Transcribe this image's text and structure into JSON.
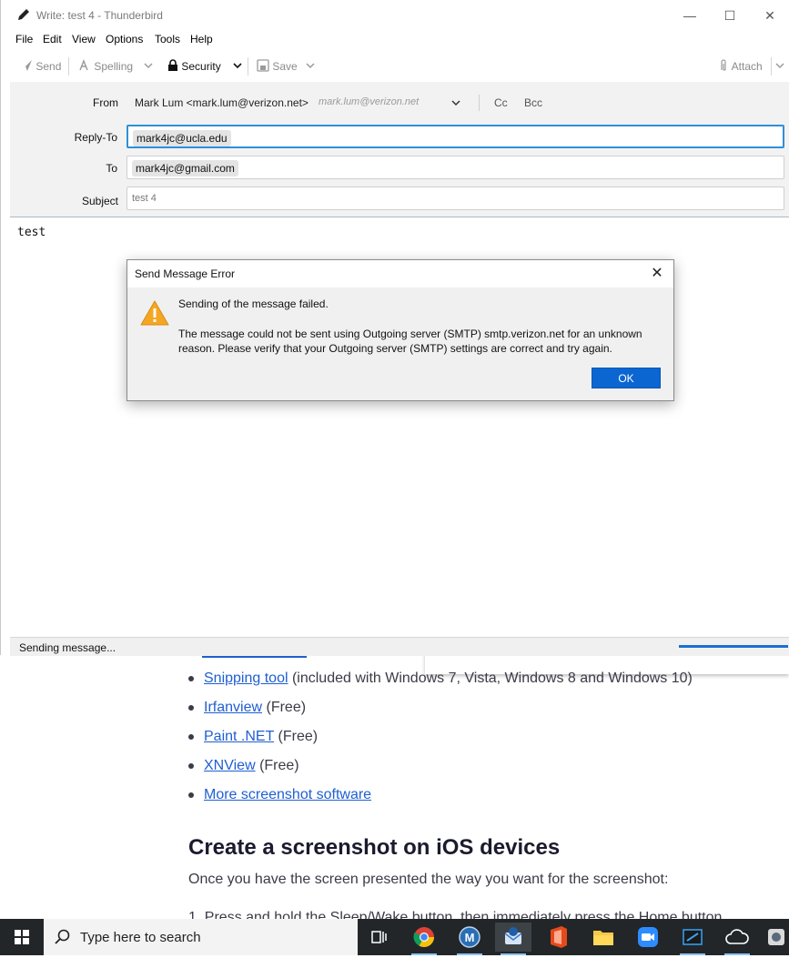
{
  "webpage": {
    "list_items": [
      {
        "link": "Snipping tool",
        "note": "(included with Windows 7, Vista, Windows 8 and Windows 10)"
      },
      {
        "link": "Irfanview",
        "note": "(Free)"
      },
      {
        "link": "Paint .NET",
        "note": "(Free)"
      },
      {
        "link": "XNView",
        "note": "(Free)"
      },
      {
        "link": "More screenshot software",
        "note": ""
      }
    ],
    "heading": "Create a screenshot on iOS devices",
    "paragraph": "Once you have the screen presented the way you want for the screenshot:",
    "cut_text": "1. Press and hold the Sleep/Wake button, then immediately press the Home button"
  },
  "window": {
    "title": "Write: test 4 - Thunderbird",
    "menu": [
      "File",
      "Edit",
      "View",
      "Options",
      "Tools",
      "Help"
    ],
    "toolbar": {
      "send": "Send",
      "spelling": "Spelling",
      "security": "Security",
      "save": "Save",
      "attach": "Attach"
    },
    "headers": {
      "from_label": "From",
      "from_value": "Mark Lum <mark.lum@verizon.net>",
      "from_ghost": "mark.lum@verizon.net",
      "cc": "Cc",
      "bcc": "Bcc",
      "reply_to_label": "Reply-To",
      "reply_to_value": "mark4jc@ucla.edu",
      "to_label": "To",
      "to_value": "mark4jc@gmail.com",
      "subject_label": "Subject",
      "subject_value": "test 4"
    },
    "body_text": "test",
    "status_text": "Sending message..."
  },
  "dialog": {
    "title": "Send Message Error",
    "message_1": "Sending of the message failed.",
    "message_2": "The message could not be sent using Outgoing server (SMTP) smtp.verizon.net for an unknown reason. Please verify that your Outgoing server (SMTP) settings are correct and try again.",
    "ok_label": "OK"
  },
  "taskbar": {
    "search_placeholder": "Type here to search",
    "apps": [
      "task-view-icon",
      "chrome-icon",
      "m-app-icon",
      "thunderbird-icon",
      "office-icon",
      "file-explorer-icon",
      "zoom-icon",
      "screen-recorder-icon",
      "cloud-app-icon",
      "extra-app-icon"
    ]
  },
  "colors": {
    "accent": "#0b66d1",
    "link": "#1f5fd1",
    "warning": "#f5a623",
    "taskbar": "#222629"
  }
}
